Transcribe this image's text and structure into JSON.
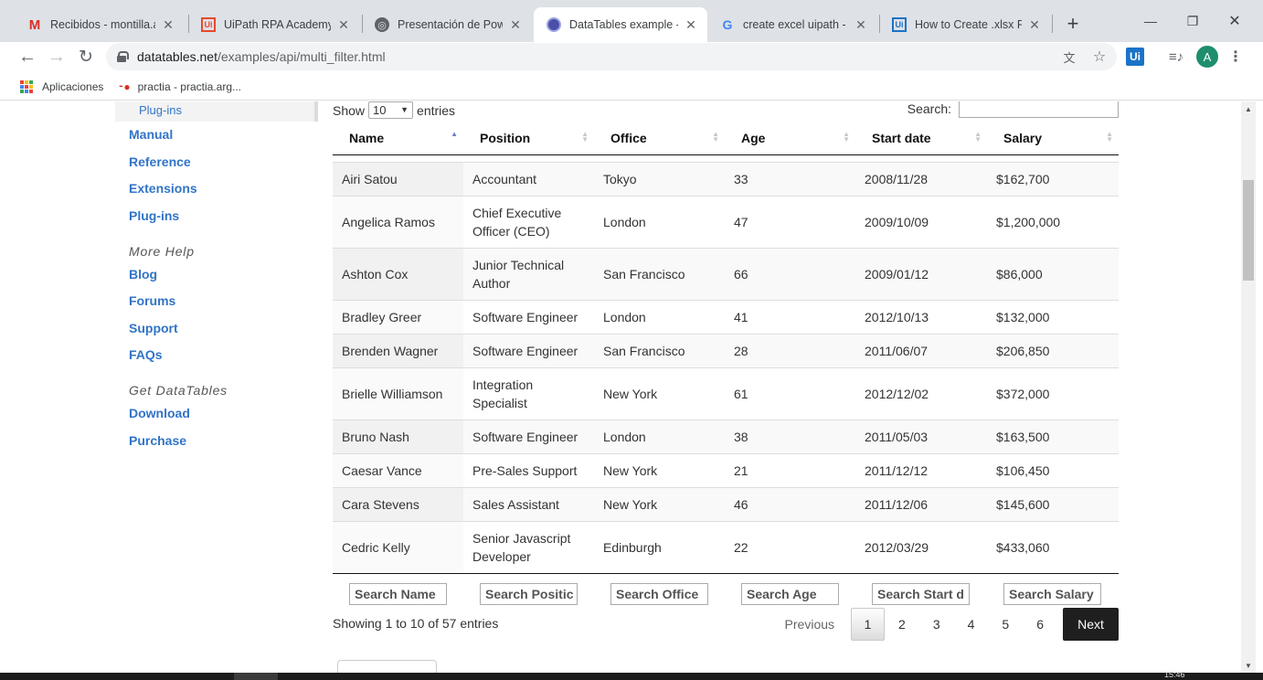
{
  "browser": {
    "tabs": [
      {
        "title": "Recibidos - montilla.ang",
        "icon": "gmail-icon",
        "active": false
      },
      {
        "title": "UiPath RPA Academy",
        "icon": "uipath-icon",
        "active": false
      },
      {
        "title": "Presentación de PowerP",
        "icon": "globe-icon",
        "active": false
      },
      {
        "title": "DataTables example - In",
        "icon": "datatables-icon",
        "active": true
      },
      {
        "title": "create excel uipath - Bu",
        "icon": "google-icon",
        "active": false
      },
      {
        "title": "How to Create .xlsx File",
        "icon": "uipath-icon",
        "active": false
      }
    ],
    "url_domain": "datatables.net",
    "url_path": "/examples/api/multi_filter.html",
    "profile_initial": "A",
    "ext_label": "Ui",
    "bookmarks": [
      {
        "label": "Aplicaciones",
        "icon": "apps-grid-icon"
      },
      {
        "label": "practia - practia.arg...",
        "icon": "practia-icon"
      }
    ],
    "clock_fragment": "15:46"
  },
  "sidebar": {
    "sub_item": "Plug-ins",
    "links_top": [
      "Manual",
      "Reference",
      "Extensions",
      "Plug-ins"
    ],
    "more_help_heading": "More Help",
    "links_help": [
      "Blog",
      "Forums",
      "Support",
      "FAQs"
    ],
    "get_heading": "Get DataTables",
    "links_get": [
      "Download",
      "Purchase"
    ]
  },
  "table": {
    "length_prefix": "Show",
    "length_value": "10",
    "length_suffix": "entries",
    "search_label": "Search:",
    "columns": [
      "Name",
      "Position",
      "Office",
      "Age",
      "Start date",
      "Salary"
    ],
    "sorted_column": "Name",
    "rows": [
      [
        "Airi Satou",
        "Accountant",
        "Tokyo",
        "33",
        "2008/11/28",
        "$162,700"
      ],
      [
        "Angelica Ramos",
        "Chief Executive Officer (CEO)",
        "London",
        "47",
        "2009/10/09",
        "$1,200,000"
      ],
      [
        "Ashton Cox",
        "Junior Technical Author",
        "San Francisco",
        "66",
        "2009/01/12",
        "$86,000"
      ],
      [
        "Bradley Greer",
        "Software Engineer",
        "London",
        "41",
        "2012/10/13",
        "$132,000"
      ],
      [
        "Brenden Wagner",
        "Software Engineer",
        "San Francisco",
        "28",
        "2011/06/07",
        "$206,850"
      ],
      [
        "Brielle Williamson",
        "Integration Specialist",
        "New York",
        "61",
        "2012/12/02",
        "$372,000"
      ],
      [
        "Bruno Nash",
        "Software Engineer",
        "London",
        "38",
        "2011/05/03",
        "$163,500"
      ],
      [
        "Caesar Vance",
        "Pre-Sales Support",
        "New York",
        "21",
        "2011/12/12",
        "$106,450"
      ],
      [
        "Cara Stevens",
        "Sales Assistant",
        "New York",
        "46",
        "2011/12/06",
        "$145,600"
      ],
      [
        "Cedric Kelly",
        "Senior Javascript Developer",
        "Edinburgh",
        "22",
        "2012/03/29",
        "$433,060"
      ]
    ],
    "footer_search": [
      "Search Name",
      "Search Positic",
      "Search Office",
      "Search Age",
      "Search Start d",
      "Search Salary"
    ],
    "info": "Showing 1 to 10 of 57 entries",
    "pagination": {
      "previous": "Previous",
      "pages": [
        "1",
        "2",
        "3",
        "4",
        "5",
        "6"
      ],
      "current": "1",
      "next": "Next"
    }
  }
}
